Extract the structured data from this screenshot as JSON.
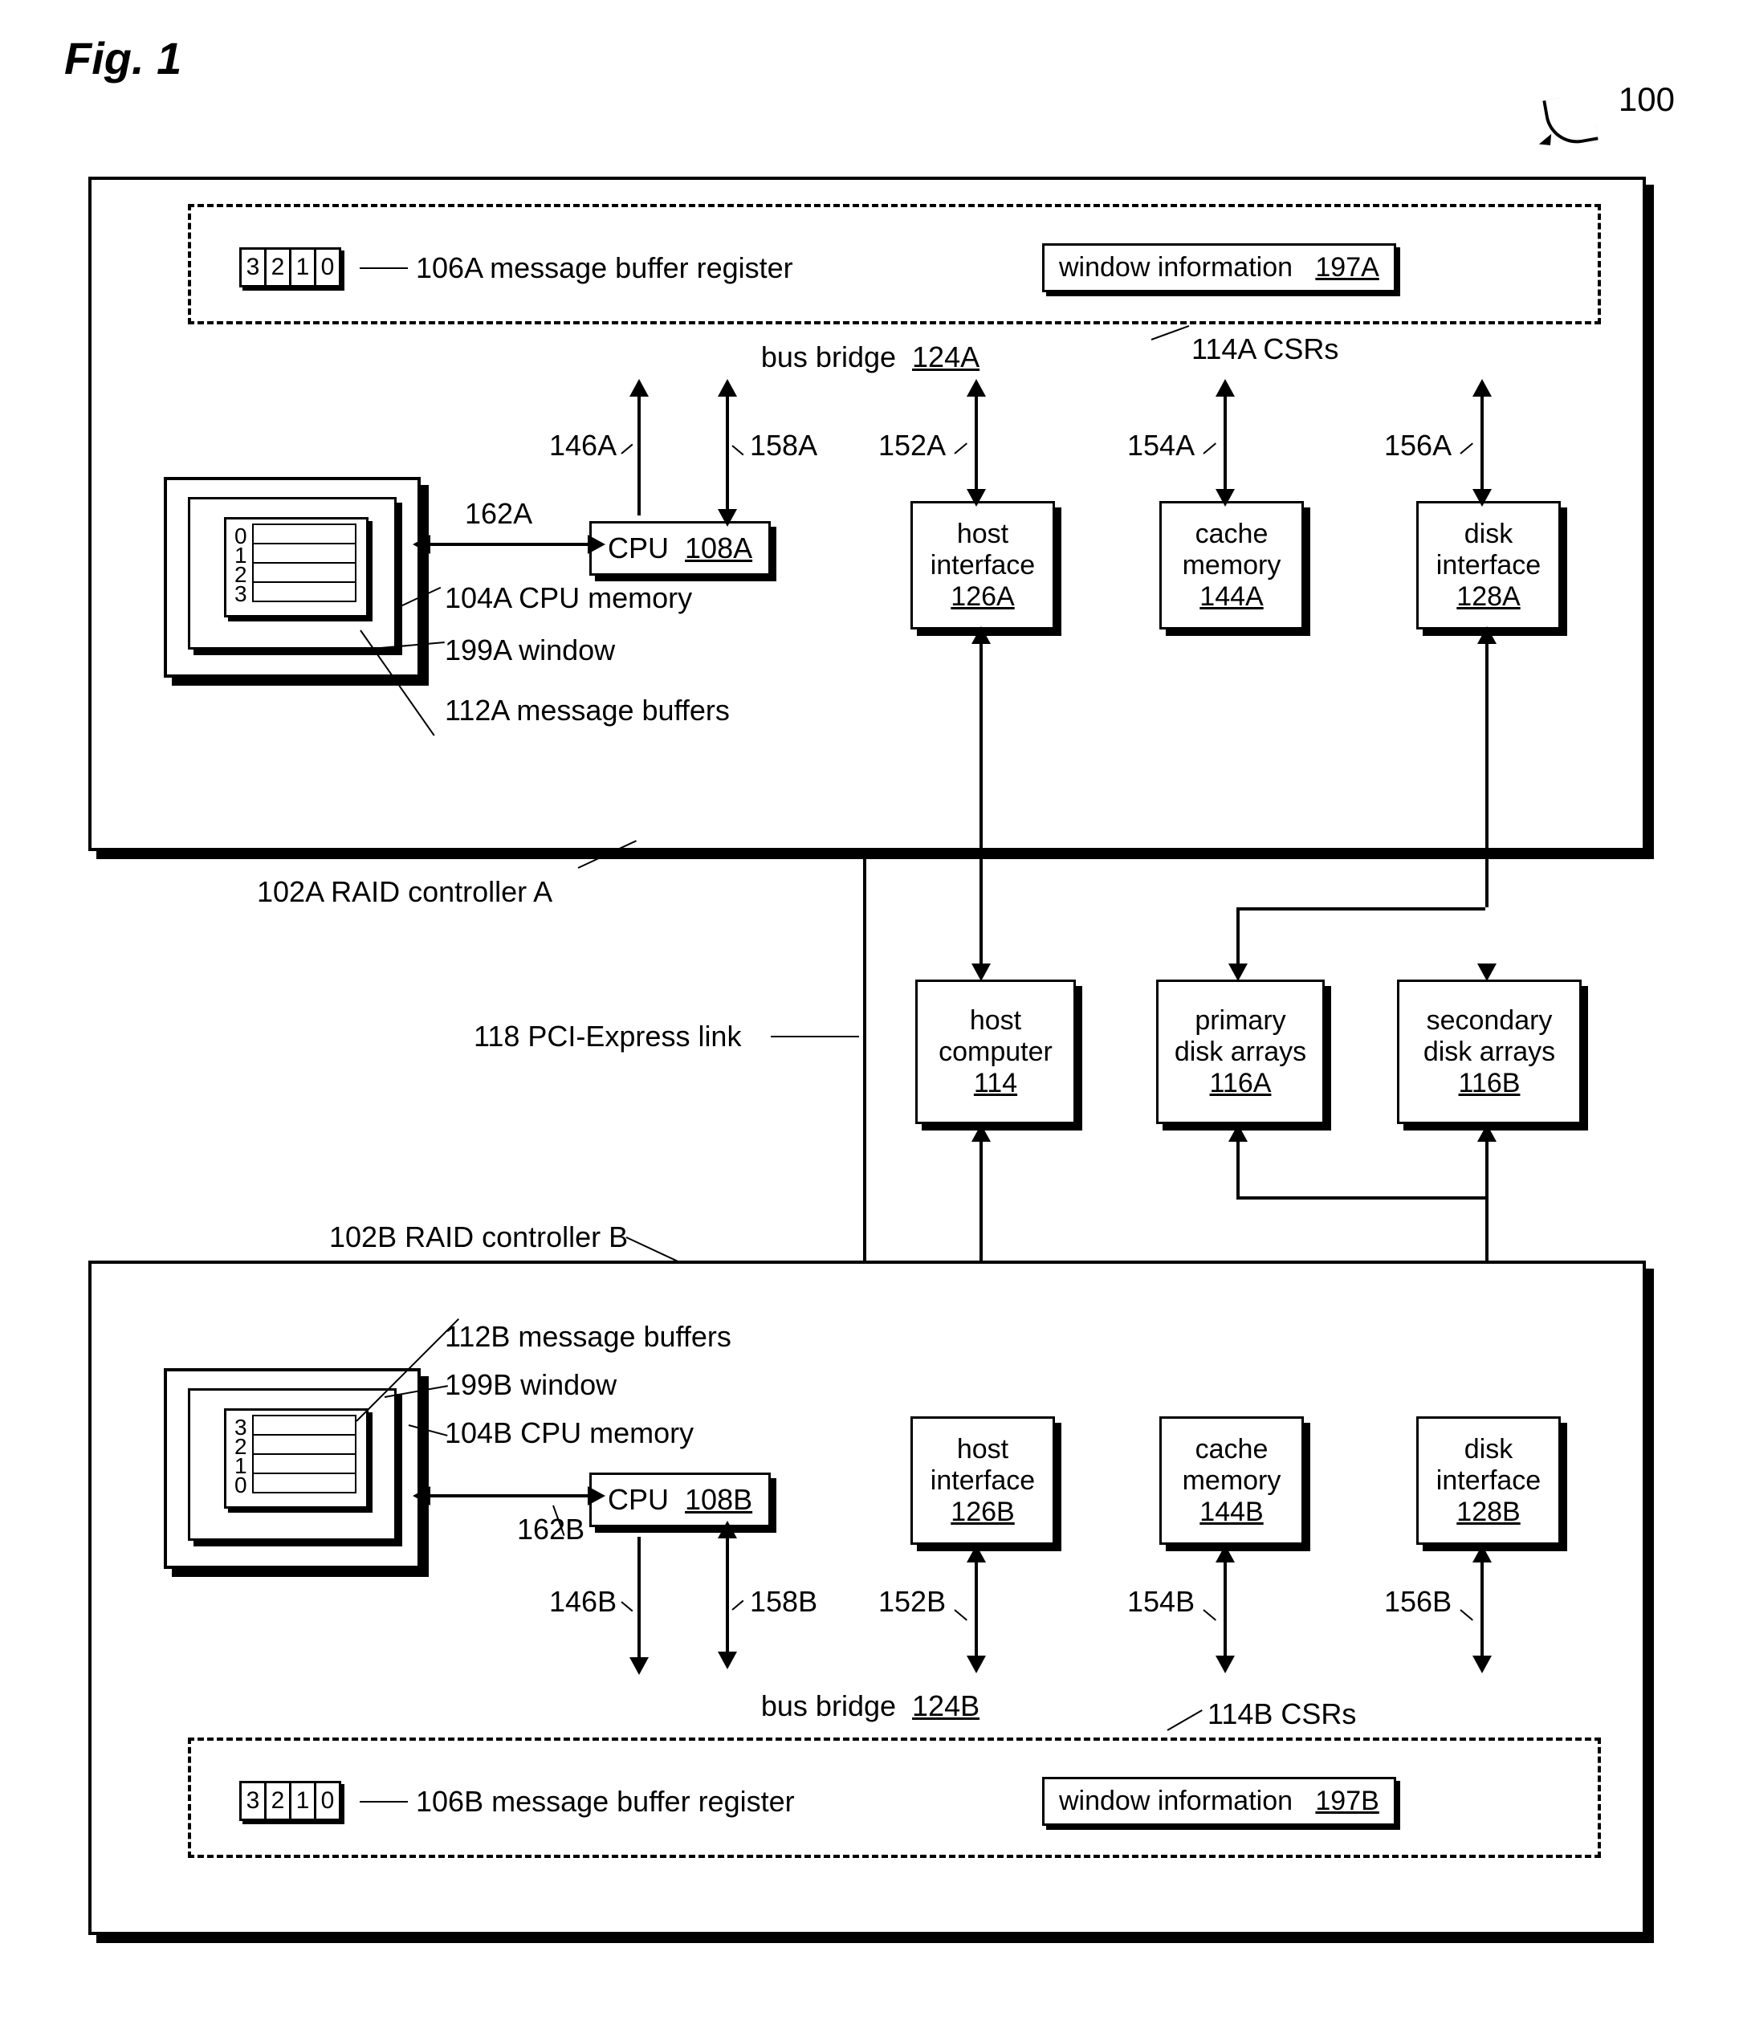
{
  "figure_title": "Fig. 1",
  "ref_num": "100",
  "controller_a": {
    "label": "102A  RAID controller A",
    "csrs_label": "114A CSRs",
    "mbr_label": "106A  message buffer register",
    "mbr_cells": [
      "3",
      "2",
      "1",
      "0"
    ],
    "wi_text": "window information",
    "wi_ref": "197A",
    "bus_bridge": "bus bridge",
    "bus_bridge_ref": "124A",
    "cpu": "CPU",
    "cpu_ref": "108A",
    "mem_nums": [
      "0",
      "1",
      "2",
      "3"
    ],
    "mem_label_cpu": "104A  CPU memory",
    "mem_label_window": "199A  window",
    "mem_label_buffers": "112A message buffers",
    "host_if": "host\ninterface",
    "host_if_ref": "126A",
    "cache": "cache\nmemory",
    "cache_ref": "144A",
    "disk_if": "disk\ninterface",
    "disk_if_ref": "128A",
    "l146": "146A",
    "l158": "158A",
    "l152": "152A",
    "l154": "154A",
    "l156": "156A",
    "l162": "162A"
  },
  "middle": {
    "pci_label": "118  PCI-Express link",
    "host": "host\ncomputer",
    "host_ref": "114",
    "primary": "primary\ndisk arrays",
    "primary_ref": "116A",
    "secondary": "secondary\ndisk arrays",
    "secondary_ref": "116B"
  },
  "controller_b": {
    "label": "102B  RAID controller B",
    "csrs_label": "114B  CSRs",
    "mbr_label": "106B  message buffer register",
    "mbr_cells": [
      "3",
      "2",
      "1",
      "0"
    ],
    "wi_text": "window information",
    "wi_ref": "197B",
    "bus_bridge": "bus bridge",
    "bus_bridge_ref": "124B",
    "cpu": "CPU",
    "cpu_ref": "108B",
    "mem_nums": [
      "3",
      "2",
      "1",
      "0"
    ],
    "mem_label_cpu": "104B  CPU memory",
    "mem_label_window": "199B  window",
    "mem_label_buffers": "112B message buffers",
    "host_if": "host\ninterface",
    "host_if_ref": "126B",
    "cache": "cache\nmemory",
    "cache_ref": "144B",
    "disk_if": "disk\ninterface",
    "disk_if_ref": "128B",
    "l146": "146B",
    "l158": "158B",
    "l152": "152B",
    "l154": "154B",
    "l156": "156B",
    "l162": "162B"
  }
}
